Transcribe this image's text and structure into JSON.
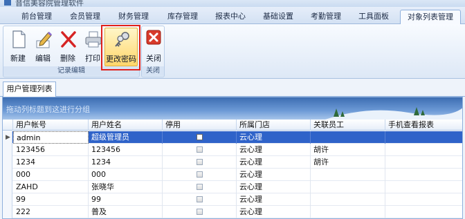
{
  "window": {
    "title": "音信美容院管理软件"
  },
  "menu": {
    "tabs": [
      {
        "label": "前台管理"
      },
      {
        "label": "会员管理"
      },
      {
        "label": "财务管理"
      },
      {
        "label": "库存管理"
      },
      {
        "label": "报表中心"
      },
      {
        "label": "基础设置"
      },
      {
        "label": "考勤管理"
      },
      {
        "label": "工具面板"
      },
      {
        "label": "对象列表管理"
      }
    ],
    "active_index": 8
  },
  "ribbon": {
    "groups": [
      {
        "label": "记录编辑",
        "buttons": [
          {
            "label": "新建",
            "icon": "new-document-icon"
          },
          {
            "label": "编辑",
            "icon": "edit-pencil-icon"
          },
          {
            "label": "删除",
            "icon": "delete-x-icon"
          },
          {
            "label": "打印",
            "icon": "printer-icon"
          },
          {
            "label": "更改密码",
            "icon": "key-icon"
          }
        ]
      },
      {
        "label": "关闭",
        "buttons": [
          {
            "label": "关闭",
            "icon": "close-red-icon"
          }
        ]
      }
    ],
    "highlight_color": "#e0201b"
  },
  "subtab": {
    "label": "用户管理列表"
  },
  "grid": {
    "group_hint": "拖动列标题到这进行分组",
    "columns": [
      "用户帐号",
      "用户姓名",
      "停用",
      "所属门店",
      "关联员工",
      "手机查看报表"
    ],
    "rows": [
      {
        "account": "admin",
        "name": "超级管理员",
        "disabled": false,
        "store": "云心理",
        "employee": "",
        "mobile": ""
      },
      {
        "account": "123456",
        "name": "123456",
        "disabled": false,
        "store": "云心理",
        "employee": "胡许",
        "mobile": ""
      },
      {
        "account": "1234",
        "name": "1234",
        "disabled": false,
        "store": "云心理",
        "employee": "胡许",
        "mobile": ""
      },
      {
        "account": "000",
        "name": "000",
        "disabled": false,
        "store": "云心理",
        "employee": "",
        "mobile": ""
      },
      {
        "account": "ZAHD",
        "name": "张晓华",
        "disabled": false,
        "store": "云心理",
        "employee": "",
        "mobile": ""
      },
      {
        "account": "99",
        "name": "99",
        "disabled": false,
        "store": "云心理",
        "employee": "",
        "mobile": ""
      },
      {
        "account": "222",
        "name": "普及",
        "disabled": false,
        "store": "云心理",
        "employee": "",
        "mobile": ""
      }
    ],
    "selected_index": 0,
    "selection_color": "#2f63c9"
  }
}
